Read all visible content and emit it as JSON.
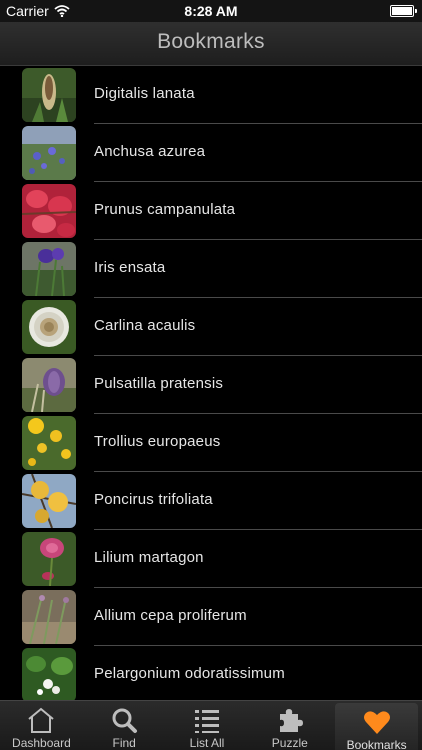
{
  "status": {
    "carrier": "Carrier",
    "time": "8:28 AM"
  },
  "nav": {
    "title": "Bookmarks"
  },
  "bookmarks": [
    {
      "name": "Digitalis lanata",
      "thumb": "digitalis-photo"
    },
    {
      "name": "Anchusa azurea",
      "thumb": "anchusa-photo"
    },
    {
      "name": "Prunus campanulata",
      "thumb": "prunus-photo"
    },
    {
      "name": "Iris ensata",
      "thumb": "iris-photo"
    },
    {
      "name": "Carlina acaulis",
      "thumb": "carlina-photo"
    },
    {
      "name": "Pulsatilla pratensis",
      "thumb": "pulsatilla-photo"
    },
    {
      "name": "Trollius europaeus",
      "thumb": "trollius-photo"
    },
    {
      "name": "Poncirus trifoliata",
      "thumb": "poncirus-photo"
    },
    {
      "name": "Lilium martagon",
      "thumb": "lilium-photo"
    },
    {
      "name": "Allium cepa proliferum",
      "thumb": "allium-photo"
    },
    {
      "name": "Pelargonium odoratissimum",
      "thumb": "pelargonium-photo"
    }
  ],
  "tabs": [
    {
      "label": "Dashboard",
      "icon": "home-icon"
    },
    {
      "label": "Find",
      "icon": "search-icon"
    },
    {
      "label": "List All",
      "icon": "list-icon"
    },
    {
      "label": "Puzzle",
      "icon": "puzzle-icon"
    },
    {
      "label": "Bookmarks",
      "icon": "heart-icon",
      "selected": true
    }
  ],
  "colors": {
    "accent": "#ff8a1c",
    "background": "#000000",
    "separator": "#4a4a4a"
  }
}
